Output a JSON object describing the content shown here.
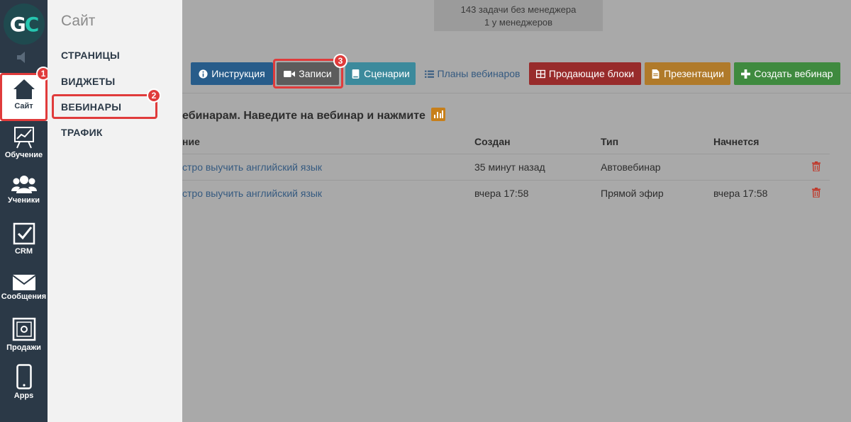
{
  "rail": {
    "logo_text_g": "G",
    "logo_text_c": "C",
    "items": [
      {
        "label": "Сайт",
        "icon": "home-icon"
      },
      {
        "label": "Обучение",
        "icon": "chart-board-icon"
      },
      {
        "label": "Ученики",
        "icon": "users-icon"
      },
      {
        "label": "CRM",
        "icon": "checkbox-icon"
      },
      {
        "label": "Сообщения",
        "icon": "envelope-icon"
      },
      {
        "label": "Продажи",
        "icon": "safe-icon"
      },
      {
        "label": "Apps",
        "icon": "phone-icon"
      }
    ]
  },
  "flyout": {
    "title": "Сайт",
    "items": [
      "СТРАНИЦЫ",
      "ВИДЖЕТЫ",
      "ВЕБИНАРЫ",
      "ТРАФИК"
    ]
  },
  "badges": [
    "1",
    "2",
    "3"
  ],
  "stats": {
    "line1": "143 задачи без менеджера",
    "line2": "1 у менеджеров"
  },
  "toolbar": {
    "instruction": "Инструкция",
    "records": "Записи",
    "scenarios": "Сценарии",
    "plans": "Планы вебинаров",
    "selling_blocks": "Продающие блоки",
    "presentations": "Презентации",
    "create": "Создать вебинар"
  },
  "hint": "ебинарам. Наведите на вебинар и нажмите",
  "table": {
    "headers": [
      "ние",
      "Создан",
      "Тип",
      "Начнется"
    ],
    "rows": [
      {
        "name": "стро выучить английский язык",
        "created": "35 минут назад",
        "type": "Автовебинар",
        "starts": ""
      },
      {
        "name": "стро выучить английский язык",
        "created": "вчера 17:58",
        "type": "Прямой эфир",
        "starts": "вчера 17:58"
      }
    ]
  },
  "colors": {
    "rail_bg": "#2b3947",
    "highlight": "#e03b3b",
    "accent_teal": "#26c6b0"
  }
}
